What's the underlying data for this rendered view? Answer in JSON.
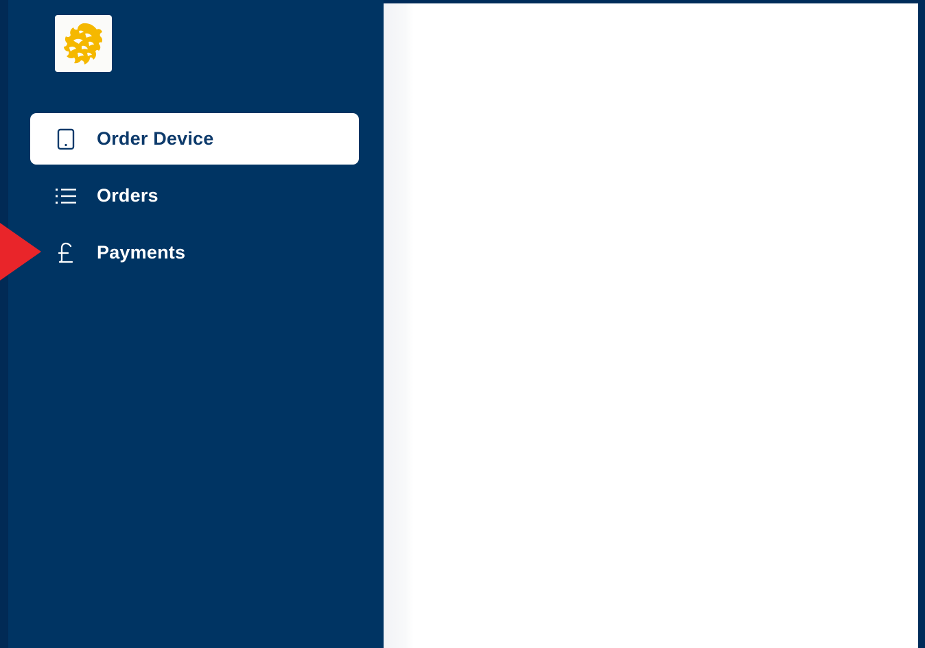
{
  "app": {
    "logo_icon": "golden-lion-logo",
    "colors": {
      "sidebar": "#003463",
      "active_item_bg": "#ffffff",
      "active_item_text": "#0d3a6b",
      "inactive_text": "#ffffff",
      "logo_gold": "#f5b800",
      "pointer": "#e9252a"
    }
  },
  "sidebar": {
    "items": [
      {
        "label": "Order Device",
        "icon": "tablet-icon",
        "active": true
      },
      {
        "label": "Orders",
        "icon": "list-icon",
        "active": false
      },
      {
        "label": "Payments",
        "icon": "pound-icon",
        "active": false
      }
    ]
  },
  "annotation": {
    "pointer_icon": "red-arrow-pointer",
    "target": "Payments"
  }
}
